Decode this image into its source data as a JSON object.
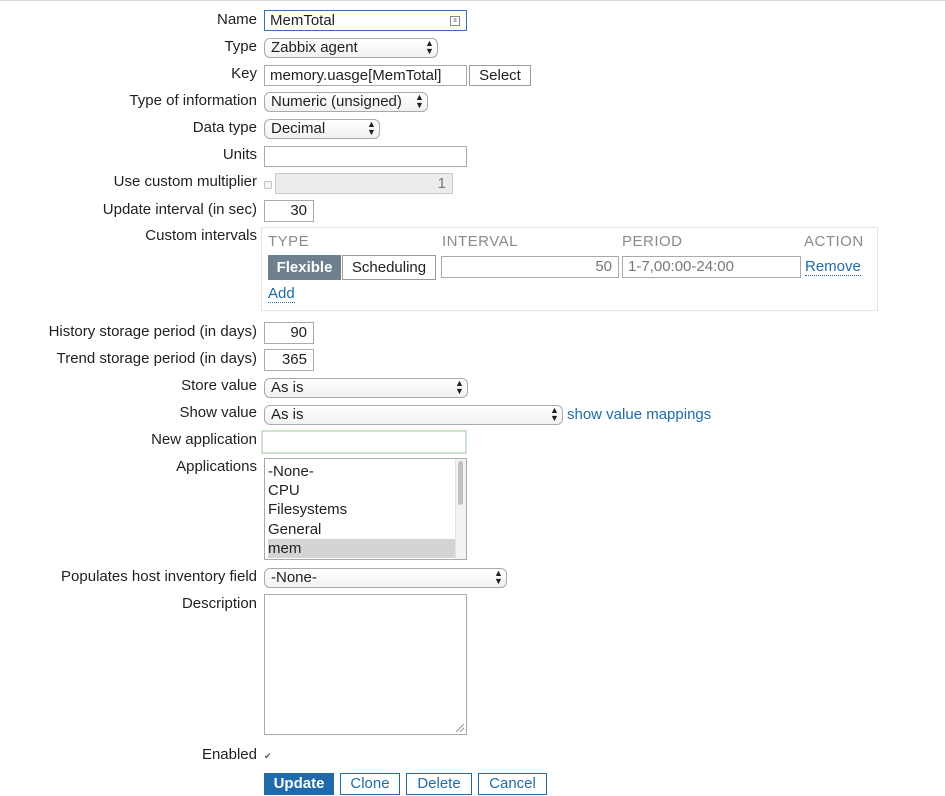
{
  "labels": {
    "name": "Name",
    "type": "Type",
    "key": "Key",
    "type_of_information": "Type of information",
    "data_type": "Data type",
    "units": "Units",
    "use_custom_multiplier": "Use custom multiplier",
    "update_interval": "Update interval (in sec)",
    "custom_intervals": "Custom intervals",
    "history_storage": "History storage period (in days)",
    "trend_storage": "Trend storage period (in days)",
    "store_value": "Store value",
    "show_value": "Show value",
    "new_application": "New application",
    "applications": "Applications",
    "populates_inventory": "Populates host inventory field",
    "description": "Description",
    "enabled": "Enabled"
  },
  "fields": {
    "name": "MemTotal",
    "type": "Zabbix agent",
    "key": "memory.uasge[MemTotal]",
    "key_select": "Select",
    "type_of_information": "Numeric (unsigned)",
    "data_type": "Decimal",
    "units": "",
    "multiplier": "1",
    "update_interval": "30",
    "history_storage": "90",
    "trend_storage": "365",
    "store_value": "As is",
    "show_value": "As is",
    "show_value_mappings": "show value mappings",
    "new_application": "",
    "populates_inventory": "-None-",
    "description": ""
  },
  "custom_intervals": {
    "headers": [
      "TYPE",
      "INTERVAL",
      "PERIOD",
      "ACTION"
    ],
    "flexible_label": "Flexible",
    "scheduling_label": "Scheduling",
    "interval_value": "50",
    "period_value": "1-7,00:00-24:00",
    "remove_label": "Remove",
    "add_label": "Add"
  },
  "applications": [
    "-None-",
    "CPU",
    "Filesystems",
    "General",
    "mem"
  ],
  "applications_selected": "mem",
  "enabled": true,
  "buttons": {
    "update": "Update",
    "clone": "Clone",
    "delete": "Delete",
    "cancel": "Cancel"
  },
  "colors": {
    "link": "#1e6aaa",
    "primary_button": "#1e6aaa",
    "flexible_active": "#6e7f8d",
    "focused_border": "#2f75b5"
  }
}
